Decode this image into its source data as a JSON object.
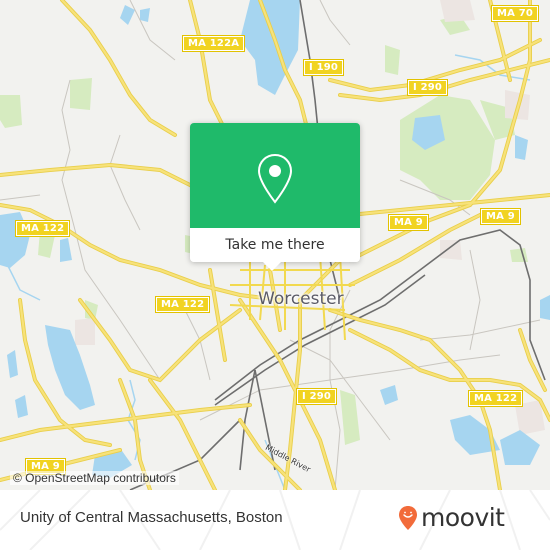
{
  "map": {
    "city_label": "Worcester",
    "river_label": "Middle River",
    "attribution": "© OpenStreetMap contributors",
    "road_shields": [
      {
        "id": "ma122a",
        "label": "MA 122A"
      },
      {
        "id": "i190",
        "label": "I 190"
      },
      {
        "id": "ma70",
        "label": "MA 70"
      },
      {
        "id": "i290-north",
        "label": "I 290"
      },
      {
        "id": "ma122-west",
        "label": "MA 122"
      },
      {
        "id": "ma9-east",
        "label": "MA 9"
      },
      {
        "id": "ma9-east2",
        "label": "MA 9"
      },
      {
        "id": "ma122-center",
        "label": "MA 122"
      },
      {
        "id": "i290-south",
        "label": "I 290"
      },
      {
        "id": "ma122-east",
        "label": "MA 122"
      },
      {
        "id": "ma9-west",
        "label": "MA 9"
      }
    ],
    "colors": {
      "background": "#f2f2ef",
      "water": "#a6d5f0",
      "park": "#d6ebc0",
      "road": "#f5e16b",
      "shield": "#f1d321"
    }
  },
  "popup": {
    "icon": "location-pin-icon",
    "action_label": "Take me there",
    "accent_color": "#1fba6a"
  },
  "footer": {
    "place_name": "Unity of Central Massachusetts, Boston",
    "brand": "moovit",
    "brand_icon": "moovit-smiley-pin-icon",
    "brand_color": "#f26b3a"
  }
}
